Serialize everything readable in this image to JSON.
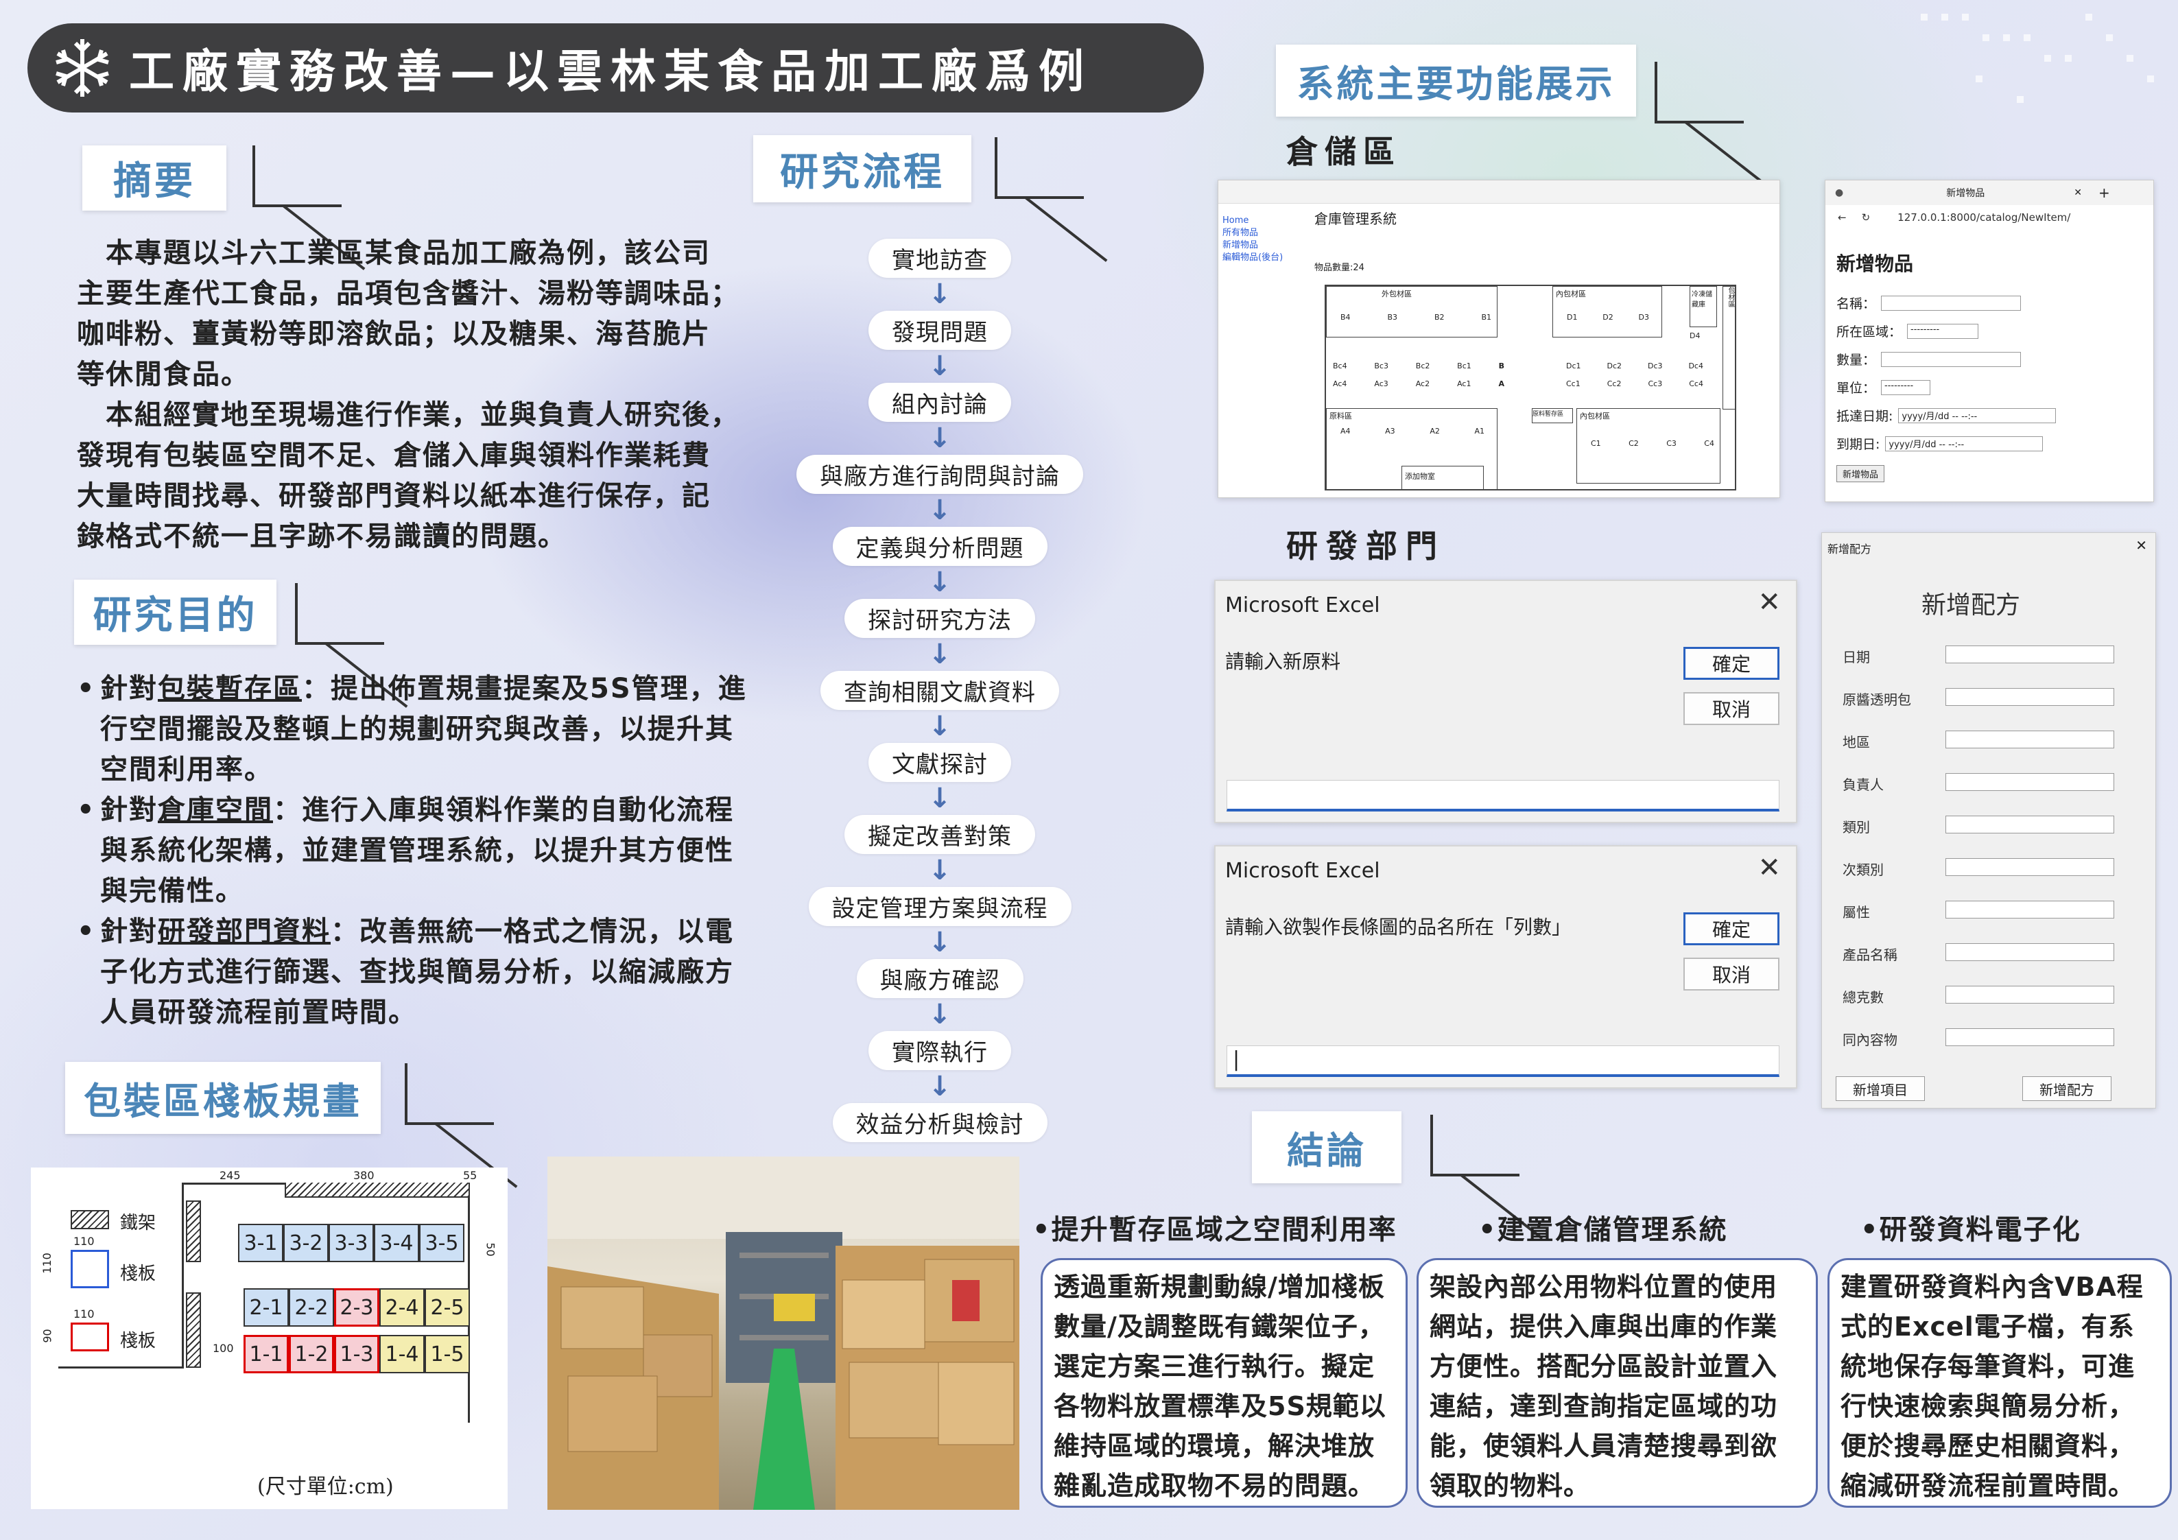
{
  "title": "工廠實務改善—以雲林某食品加工廠爲例",
  "sections": {
    "abstract": "摘要",
    "purpose": "研究目的",
    "flow": "研究流程",
    "features": "系統主要功能展示",
    "pack": "包裝區棧板規畫",
    "conclusion": "結論"
  },
  "abstract_lines": [
    "　本專題以斗六工業區某食品加工廠為例，該公司",
    "主要生產代工食品，品項包含醬汁、湯粉等調味品；",
    "咖啡粉、薑黃粉等即溶飲品；以及糖果、海苔脆片",
    "等休閒食品。",
    "　本組經實地至現場進行作業，並與負責人研究後，",
    "發現有包裝區空間不足、倉儲入庫與領料作業耗費",
    "大量時間找尋、研發部門資料以紙本進行保存，記",
    "錄格式不統一且字跡不易識讀的問題。"
  ],
  "purpose_items": [
    {
      "pre": "針對",
      "key": "包裝暫存區",
      "l1": "：提出佈置規畫提案及5S管理，進",
      "rest": [
        "行空間擺設及整頓上的規劃研究與改善，以提升其",
        "空間利用率。"
      ]
    },
    {
      "pre": "針對",
      "key": "倉庫空間",
      "l1": "：進行入庫與領料作業的自動化流程",
      "rest": [
        "與系統化架構，並建置管理系統，以提升其方便性",
        "與完備性。"
      ]
    },
    {
      "pre": "針對",
      "key": "研發部門資料",
      "l1": "：改善無統一格式之情況，以電",
      "rest": [
        "子化方式進行篩選、查找與簡易分析，以縮減廠方",
        "人員研發流程前置時間。"
      ]
    }
  ],
  "flow_steps": [
    "實地訪查",
    "發現問題",
    "組內討論",
    "與廠方進行詢問與討論",
    "定義與分析問題",
    "探討研究方法",
    "查詢相關文獻資料",
    "文獻探討",
    "擬定改善對策",
    "設定管理方案與流程",
    "與廠方確認",
    "實際執行",
    "效益分析與檢討"
  ],
  "storage": {
    "label": "倉儲區",
    "page_title": "倉庫管理系統",
    "nav": [
      "Home",
      "所有物品",
      "新增物品",
      "編輯物品(後台)"
    ],
    "count_label": "物品數量:24",
    "blocks": [
      "外包材區",
      "內包材區",
      "原料區",
      "原料暫存區",
      "冷凍儲藏庫",
      "包材區",
      "添加物室"
    ],
    "rows_top": [
      "B4",
      "B3",
      "B2",
      "B1",
      "D1",
      "D2",
      "D3",
      "D4"
    ],
    "rows_mid1": [
      "Bc4",
      "Bc3",
      "Bc2",
      "Bc1",
      "B",
      "Dc1",
      "Dc2",
      "Dc3",
      "Dc4"
    ],
    "rows_mid2": [
      "Ac4",
      "Ac3",
      "Ac2",
      "Ac1",
      "A",
      "Cc1",
      "Cc2",
      "Cc3",
      "Cc4"
    ],
    "rows_bot": [
      "A4",
      "A3",
      "A2",
      "A1",
      "C1",
      "C2",
      "C3",
      "C4"
    ]
  },
  "newitem": {
    "tab": "新增物品",
    "url": "127.0.0.1:8000/catalog/NewItem/",
    "heading": "新增物品",
    "fields": [
      "名稱：",
      "所在區域：",
      "數量：",
      "單位：",
      "抵達日期:",
      "到期日:"
    ],
    "date_ph": "yyyy/月/dd -- --:--",
    "select_ph": "---------",
    "button": "新增物品"
  },
  "rd": {
    "label": "研發部門",
    "dialog1": {
      "title": "Microsoft Excel",
      "msg": "請輸入新原料",
      "ok": "確定",
      "cancel": "取消"
    },
    "dialog2": {
      "title": "Microsoft Excel",
      "msg": "請輸入欲製作長條圖的品名所在「列數」",
      "ok": "確定",
      "cancel": "取消"
    }
  },
  "recipe": {
    "title_bar": "新增配方",
    "heading": "新增配方",
    "fields": [
      "日期",
      "原醬透明包",
      "地區",
      "負責人",
      "類別",
      "次類別",
      "屬性",
      "產品名稱",
      "總克數",
      "同內容物"
    ],
    "btn_item": "新增項目",
    "btn_recipe": "新增配方"
  },
  "pallet": {
    "legend_rack": "鐵架",
    "legend_pallet": "棧板",
    "dims": [
      "245",
      "380",
      "55",
      "50",
      "110",
      "110",
      "110",
      "90",
      "100"
    ],
    "row3": [
      "3-1",
      "3-2",
      "3-3",
      "3-4",
      "3-5"
    ],
    "row2": [
      "2-1",
      "2-2",
      "2-3",
      "2-4",
      "2-5"
    ],
    "row1": [
      "1-1",
      "1-2",
      "1-3",
      "1-4",
      "1-5"
    ],
    "unit_note": "(尺寸單位:cm)"
  },
  "conclusions": [
    {
      "head": "•提升暫存區域之空間利用率",
      "lines": [
        "透過重新規劃動線/增加棧板",
        "數量/及調整既有鐵架位子，",
        "選定方案三進行執行。擬定",
        "各物料放置標準及5S規範以",
        "維持區域的環境，解決堆放",
        "雜亂造成取物不易的問題。"
      ]
    },
    {
      "head": "•建置倉儲管理系統",
      "lines": [
        "架設內部公用物料位置的使用",
        "網站，提供入庫與出庫的作業",
        "方便性。搭配分區設計並置入",
        "連結，達到查詢指定區域的功",
        "能，使領料人員清楚搜尋到欲",
        "領取的物料。"
      ]
    },
    {
      "head": "•研發資料電子化",
      "lines": [
        "建置研發資料內含VBA程",
        "式的Excel電子檔，有系",
        "統地保存每筆資料，可進",
        "行快速檢索與簡易分析，",
        "便於搜尋歷史相關資料，",
        "縮減研發流程前置時間。"
      ]
    }
  ],
  "colors": {
    "accent": "#4b86b8",
    "banner": "#3e3e40",
    "flow_arrow": "#4b6fb0",
    "excel_blue": "#2a62c0"
  }
}
